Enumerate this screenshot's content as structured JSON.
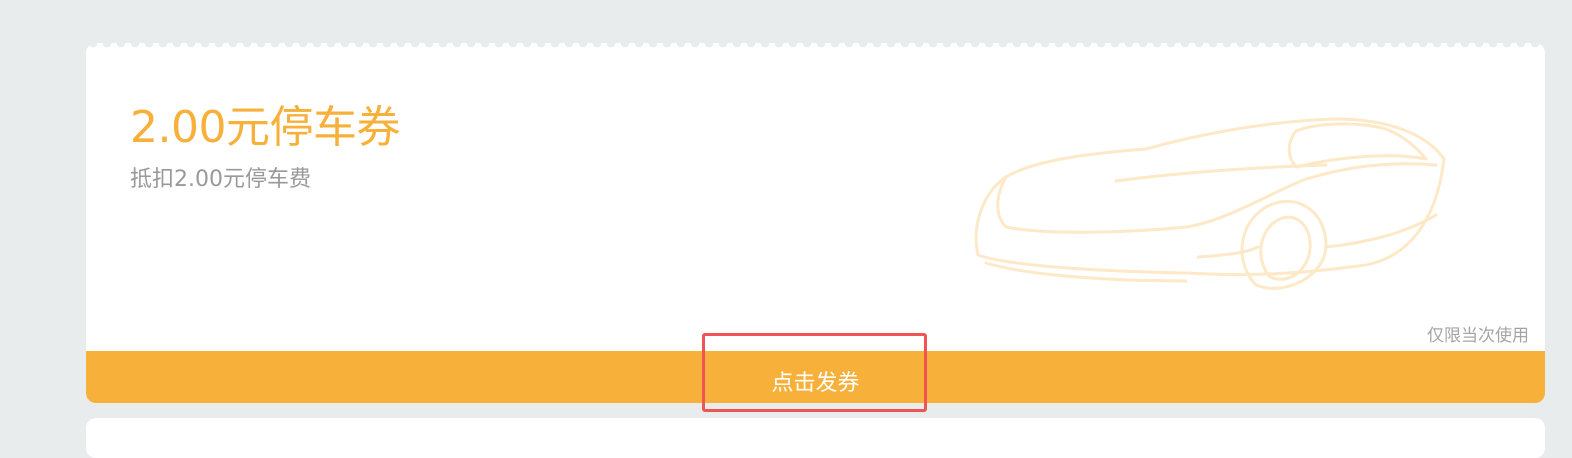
{
  "coupon": {
    "title": "2.00元停车券",
    "subtitle": "抵扣2.00元停车费",
    "usage_note": "仅限当次使用",
    "issue_button_label": "点击发券",
    "watermark_icon": "car-icon"
  },
  "colors": {
    "accent": "#f7b03a",
    "background": "#e9ecec",
    "highlight": "#f05454",
    "subtitle_text": "#999999",
    "watermark": "#fde9c8"
  }
}
